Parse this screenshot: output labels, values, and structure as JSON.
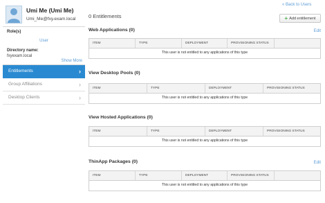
{
  "user": {
    "name": "Umi Me (Umi Me)",
    "email": "Umi_Me@fxy.exam.local"
  },
  "info": {
    "roles_label": "Role(s)",
    "roles_value": "User",
    "directory_label": "Directory name:",
    "directory_value": "fxyexam.local",
    "show_more": "Show More"
  },
  "nav": [
    {
      "label": "Entitlements",
      "active": true
    },
    {
      "label": "Group Affiliations",
      "active": false
    },
    {
      "label": "Desktop Clients",
      "active": false
    }
  ],
  "header": {
    "back_link": "« Back to Users",
    "entitlement_count": "0 Entitlements",
    "add_button": "Add entitlement"
  },
  "sections": [
    {
      "title": "Web Applications (0)",
      "edit": "Edit",
      "columns": [
        "ITEM",
        "TYPE",
        "DEPLOYMENT",
        "PROVISIONING STATUS"
      ],
      "empty_message": "This user is not entitled to any applications of this type"
    },
    {
      "title": "View Desktop Pools (0)",
      "edit": "",
      "columns": [
        "ITEM",
        "TYPE",
        "DEPLOYMENT",
        "PROVISIONING STATUS"
      ],
      "empty_message": "This user is not entitled to any applications of this type"
    },
    {
      "title": "View Hosted Applications (0)",
      "edit": "",
      "columns": [
        "ITEM",
        "TYPE",
        "DEPLOYMENT",
        "PROVISIONING STATUS"
      ],
      "empty_message": "This user is not entitled to any applications of this type"
    },
    {
      "title": "ThinApp Packages (0)",
      "edit": "Edit",
      "columns": [
        "ITEM",
        "TYPE",
        "DEPLOYMENT",
        "PROVISIONING STATUS"
      ],
      "empty_message": "This user is not entitled to any applications of this type"
    }
  ],
  "colors": {
    "accent": "#2a8ad1",
    "link": "#5b9bd5",
    "add_icon": "#4caf50"
  },
  "icons": {
    "avatar": "user-avatar-icon",
    "chevron": "chevron-right-icon",
    "add": "plus-icon"
  }
}
